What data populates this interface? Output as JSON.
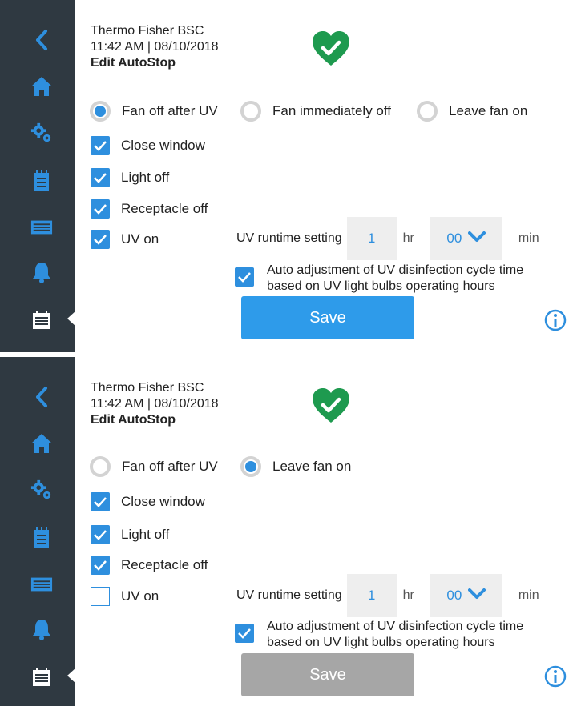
{
  "colors": {
    "sidebar": "#2f3941",
    "accent": "#2e8fde",
    "heart": "#1e9a4f",
    "save_disabled": "#a6a6a6"
  },
  "panels": [
    {
      "header": {
        "device": "Thermo Fisher BSC",
        "datetime": "11:42  AM | 08/10/2018",
        "title": "Edit AutoStop"
      },
      "status_icon": "heart-check-icon",
      "fan_options": [
        {
          "label": "Fan off after UV",
          "selected": true
        },
        {
          "label": "Fan immediately off",
          "selected": false
        },
        {
          "label": "Leave fan on",
          "selected": false
        }
      ],
      "checkboxes": [
        {
          "label": "Close window",
          "checked": true
        },
        {
          "label": "Light off",
          "checked": true
        },
        {
          "label": "Receptacle off",
          "checked": true
        },
        {
          "label": "UV on",
          "checked": true
        }
      ],
      "uv_runtime": {
        "label": "UV runtime setting",
        "hours": "1",
        "hr_unit": "hr",
        "minutes": "00",
        "min_unit": "min"
      },
      "auto_adjust": {
        "line1": "Auto adjustment of UV disinfection cycle time",
        "line2": "based on UV light bulbs operating hours",
        "checked": true
      },
      "save": {
        "label": "Save",
        "enabled": true
      }
    },
    {
      "header": {
        "device": "Thermo Fisher BSC",
        "datetime": "11:42  AM | 08/10/2018",
        "title": "Edit AutoStop"
      },
      "status_icon": "heart-check-icon",
      "fan_options": [
        {
          "label": "Fan off after UV",
          "selected": false
        },
        {
          "label": "Leave fan on",
          "selected": true
        }
      ],
      "checkboxes": [
        {
          "label": "Close window",
          "checked": true
        },
        {
          "label": "Light off",
          "checked": true
        },
        {
          "label": "Receptacle off",
          "checked": true
        },
        {
          "label": "UV on",
          "checked": false
        }
      ],
      "uv_runtime": {
        "label": "UV runtime setting",
        "hours": "1",
        "hr_unit": "hr",
        "minutes": "00",
        "min_unit": "min"
      },
      "auto_adjust": {
        "line1": "Auto adjustment of UV disinfection cycle time",
        "line2": "based on UV light bulbs operating hours",
        "checked": true
      },
      "save": {
        "label": "Save",
        "enabled": false
      }
    }
  ]
}
